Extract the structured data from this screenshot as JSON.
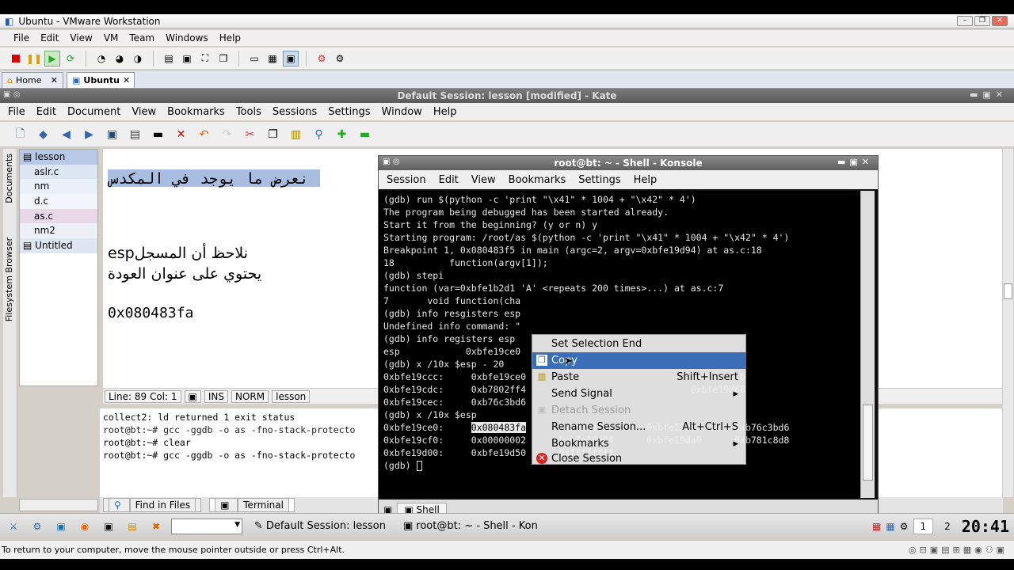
{
  "vmware": {
    "title": "Ubuntu - VMware Workstation",
    "menu": [
      "File",
      "Edit",
      "View",
      "VM",
      "Team",
      "Windows",
      "Help"
    ],
    "tabs": [
      {
        "label": "Home"
      },
      {
        "label": "Ubuntu"
      }
    ],
    "status_text": "To return to your computer, move the mouse pointer outside or press Ctrl+Alt."
  },
  "kate": {
    "title": "Default Session: lesson [modified] - Kate",
    "menu": [
      "File",
      "Edit",
      "Document",
      "View",
      "Bookmarks",
      "Tools",
      "Sessions",
      "Settings",
      "Window",
      "Help"
    ],
    "side_labels": [
      "Documents",
      "Filesystem Browser"
    ],
    "documents": [
      "lesson",
      "aslr.c",
      "nm",
      "d.c",
      "as.c",
      "nm2",
      "Untitled"
    ],
    "editor_lines": [
      "نعرض ما يوجد في المكدس",
      "",
      "نلاحظ أن المسجلesp",
      "يحتوي على عنوان العودة",
      "",
      "0x080483fa"
    ],
    "status": {
      "line_col": "Line: 89 Col: 1",
      "ins": "INS",
      "norm": "NORM",
      "doc": "lesson"
    },
    "terminal_lines": [
      "collect2: ld returned 1 exit status",
      "root@bt:~# gcc -ggdb -o as -fno-stack-protecto",
      "root@bt:~# clear",
      "root@bt:~# gcc -ggdb -o as -fno-stack-protecto"
    ],
    "bottom_tabs": [
      "Find in Files",
      "Terminal"
    ]
  },
  "konsole": {
    "title": "root@bt: ~ - Shell - Konsole",
    "menu": [
      "Session",
      "Edit",
      "View",
      "Bookmarks",
      "Settings",
      "Help"
    ],
    "lines": [
      "(gdb) run $(python -c 'print \"\\x41\" * 1004 + \"\\x42\" * 4')",
      "The program being debugged has been started already.",
      "Start it from the beginning? (y or n) y",
      "",
      "Starting program: /root/as $(python -c 'print \"\\x41\" * 1004 + \"\\x42\" * 4')",
      "",
      "Breakpoint 1, 0x080483f5 in main (argc=2, argv=0xbfe19d94) at as.c:18",
      "18          function(argv[1]);",
      "(gdb) stepi",
      "function (var=0xbfe1b2d1 'A' <repeats 200 times>...) at as.c:7",
      "7       void function(cha",
      "(gdb) info resgisters esp",
      "Undefined info command: \"",
      "(gdb) info registers esp",
      "esp            0xbfe19ce0",
      "(gdb) x /10x $esp - 20",
      "0xbfe19ccc:     0xbfe19ce0                              0x0804842b",
      "0xbfe19cdc:     0xb7802ff4                              0xbfe19d68",
      "0xbfe19cec:     0xb76c3bd6",
      "(gdb) x /10x $esp",
      "0xbfe19ce0:     ",
      "0xbfe19cf0:     0x00000002      0xbfe19d94      0xbfe19da0      0xb781c8d8",
      "0xbfe19d00:     0xbfe19d50      0xffffffff",
      "(gdb) "
    ],
    "row20_rest": "      0xbfe1b2d1      0xbfe19d68      0xb76c3bd6",
    "selected_word": "0x080483fa",
    "tab": "Shell"
  },
  "context_menu": [
    {
      "label": "Set Selection End",
      "shortcut": "",
      "state": "normal",
      "icon": ""
    },
    {
      "label": "Copy",
      "shortcut": "",
      "state": "selected",
      "icon": "copy-icon"
    },
    {
      "label": "Paste",
      "shortcut": "Shift+Insert",
      "state": "normal",
      "icon": "paste-icon"
    },
    {
      "label": "Send Signal",
      "shortcut": "▸",
      "state": "normal",
      "icon": ""
    },
    {
      "label": "Detach Session",
      "shortcut": "",
      "state": "disabled",
      "icon": "detach-icon"
    },
    {
      "label": "Rename Session...",
      "shortcut": "Alt+Ctrl+S",
      "state": "normal",
      "icon": ""
    },
    {
      "label": "Bookmarks",
      "shortcut": "▸",
      "state": "normal",
      "icon": ""
    },
    {
      "label": "Close Session",
      "shortcut": "",
      "state": "normal",
      "icon": "close-session-icon"
    }
  ],
  "taskbar": {
    "tasks": [
      "Default Session: lesson",
      "root@bt: ~ - Shell - Kon"
    ],
    "pagers": [
      "1",
      "2"
    ],
    "clock": "20:41"
  }
}
